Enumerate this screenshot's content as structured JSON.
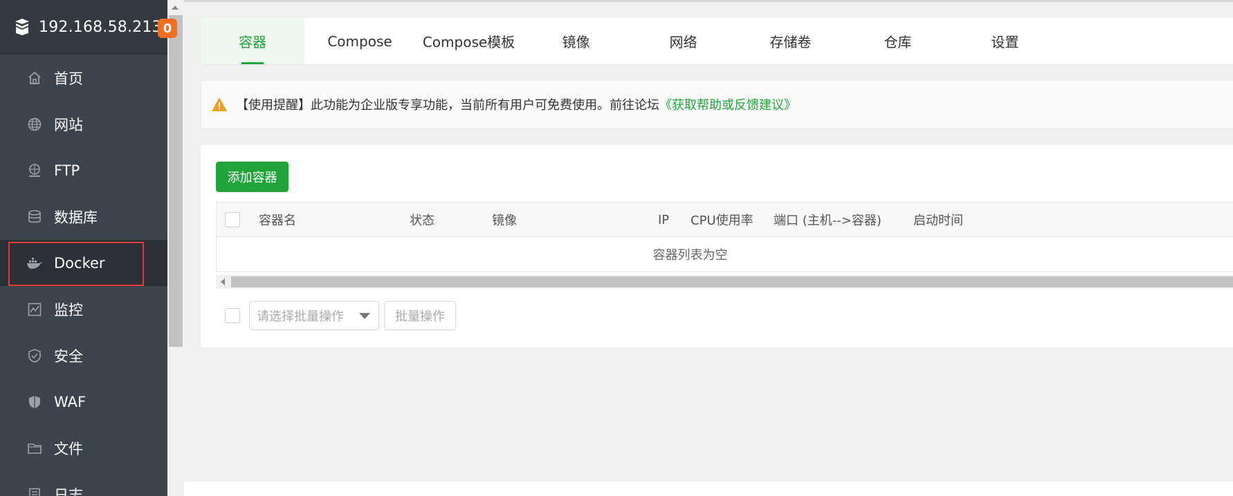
{
  "sidebar": {
    "server_ip": "192.168.58.213",
    "notification_count": "0",
    "items": [
      {
        "label": "首页",
        "icon": "home-icon"
      },
      {
        "label": "网站",
        "icon": "globe-icon"
      },
      {
        "label": "FTP",
        "icon": "ftp-icon"
      },
      {
        "label": "数据库",
        "icon": "database-icon"
      },
      {
        "label": "Docker",
        "icon": "docker-icon",
        "active": true
      },
      {
        "label": "监控",
        "icon": "monitor-icon"
      },
      {
        "label": "安全",
        "icon": "shield-icon"
      },
      {
        "label": "WAF",
        "icon": "waf-icon"
      },
      {
        "label": "文件",
        "icon": "folder-icon"
      },
      {
        "label": "日志",
        "icon": "log-icon"
      }
    ]
  },
  "tabs": [
    {
      "label": "容器",
      "active": true
    },
    {
      "label": "Compose"
    },
    {
      "label": "Compose模板"
    },
    {
      "label": "镜像"
    },
    {
      "label": "网络"
    },
    {
      "label": "存储卷"
    },
    {
      "label": "仓库"
    },
    {
      "label": "设置"
    }
  ],
  "notice": {
    "text": "【使用提醒】此功能为企业版专享功能，当前所有用户可免费使用。前往论坛",
    "link": "《获取帮助或反馈建议》"
  },
  "toolbar": {
    "add_label": "添加容器"
  },
  "table": {
    "columns": [
      "容器名",
      "状态",
      "镜像",
      "IP",
      "CPU使用率",
      "端口 (主机-->容器)",
      "启动时间"
    ],
    "empty_text": "容器列表为空"
  },
  "batch": {
    "select_placeholder": "请选择批量操作",
    "button_label": "批量操作"
  },
  "colors": {
    "accent": "#20a53a",
    "sidebar_bg": "#3c444d",
    "badge": "#f26f21",
    "highlight_border": "#e23a3a"
  }
}
